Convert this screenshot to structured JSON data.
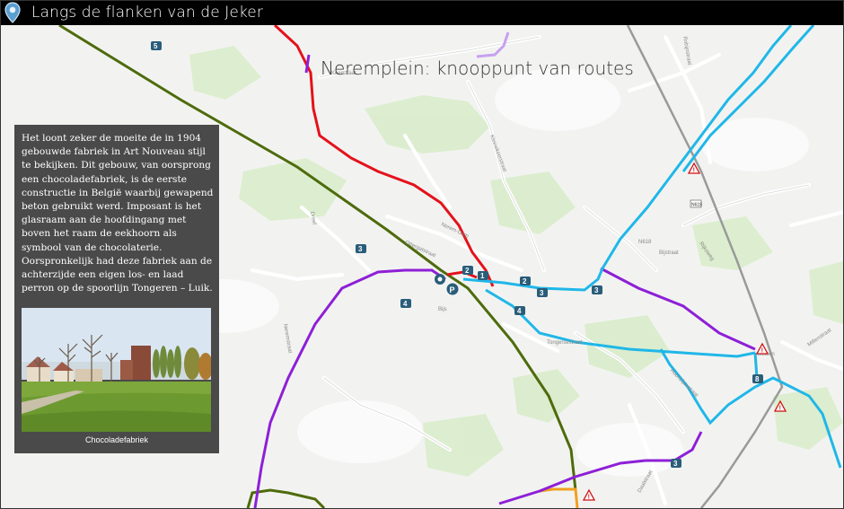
{
  "header": {
    "title": "Langs de flanken van de Jeker"
  },
  "map": {
    "title": "Nerem­plein: knooppunt van routes",
    "street_labels": [
      "Keerstraat",
      "Kleinekeerstraat",
      "Nerem-Dorp",
      "Ottergatstraat",
      "Neremstraat",
      "Rijksweg",
      "Bijs",
      "Robijnstraat",
      "Tongersestraat",
      "Sluizen",
      "Millenstraat",
      "Dreef",
      "Tongersestraat",
      "N618",
      "Bijstraat",
      "Hoonzijdestraat",
      "Daalstraat"
    ],
    "node_numbers": [
      "1",
      "2",
      "2",
      "3",
      "3",
      "3",
      "4",
      "4",
      "5",
      "8"
    ],
    "colors": {
      "red_route": "#e4121b",
      "purple_route": "#8e1fd6",
      "blue_route": "#20b7e8",
      "green_route": "#4e6b0c",
      "orange_route": "#f0a020",
      "rail": "#9a9a9a",
      "forest": "#d6ecc8"
    }
  },
  "info_panel": {
    "text": "Het loont zeker de moeite de in 1904 gebouwde fabriek in Art Nouveau stijl te bekijken. Dit gebouw, van oorsprong een chocoladefabriek, is de eerste constructie in België waarbij gewapend beton gebruikt werd. Imposant is het glasraam aan de hoofdingang met boven het raam de eekhoorn als symbool van de chocolaterie. Oorspronkelijk had deze fabriek aan de achterzijde een eigen los- en laad perron op de spoorlijn Tongeren – Luik.",
    "photo_caption": "Chocoladefabriek"
  }
}
